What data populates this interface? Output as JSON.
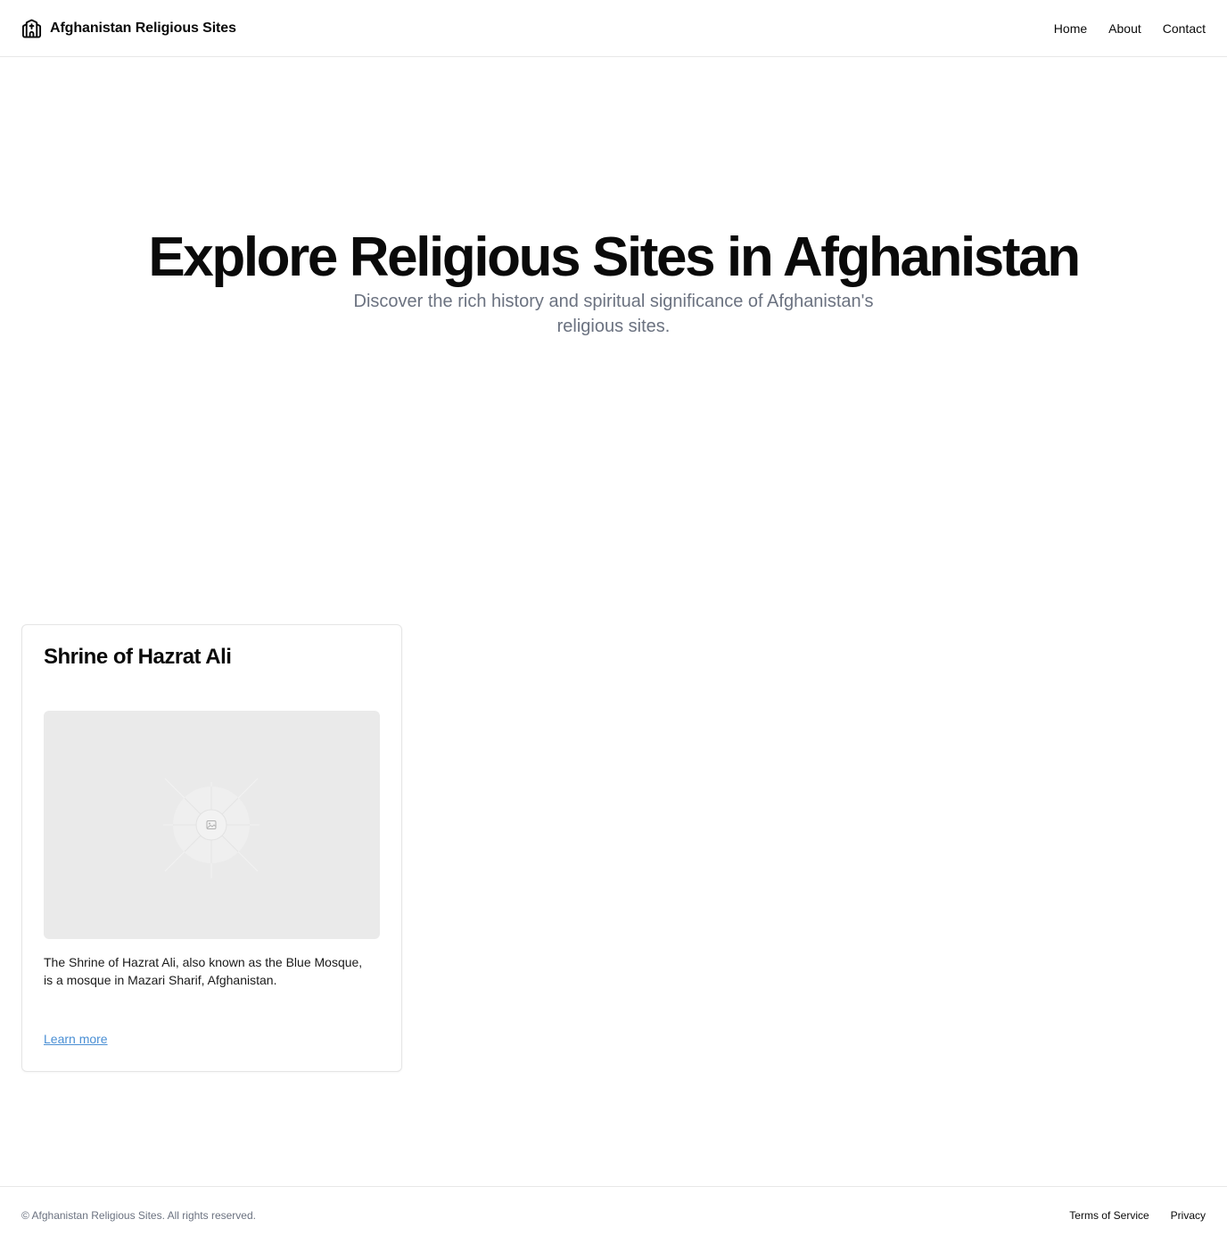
{
  "header": {
    "brand_icon": "church-icon",
    "brand": "Afghanistan Religious Sites",
    "nav": [
      {
        "label": "Home"
      },
      {
        "label": "About"
      },
      {
        "label": "Contact"
      }
    ]
  },
  "hero": {
    "title": "Explore Religious Sites in Afghanistan",
    "subtitle": "Discover the rich history and spiritual significance of Afghanistan's religious sites."
  },
  "sites": [
    {
      "title": "Shrine of Hazrat Ali",
      "image_icon": "image-placeholder-icon",
      "description": "The Shrine of Hazrat Ali, also known as the Blue Mosque, is a mosque in Mazari Sharif, Afghanistan.",
      "link": "Learn more"
    }
  ],
  "footer": {
    "copyright": "© Afghanistan Religious Sites. All rights reserved.",
    "links": [
      {
        "label": "Terms of Service"
      },
      {
        "label": "Privacy"
      }
    ]
  },
  "colors": {
    "text": "#0a0a0a",
    "muted": "#6b7280",
    "link": "#4a8fd4",
    "border": "#e5e5e5",
    "placeholder_bg": "#eaeaea"
  }
}
